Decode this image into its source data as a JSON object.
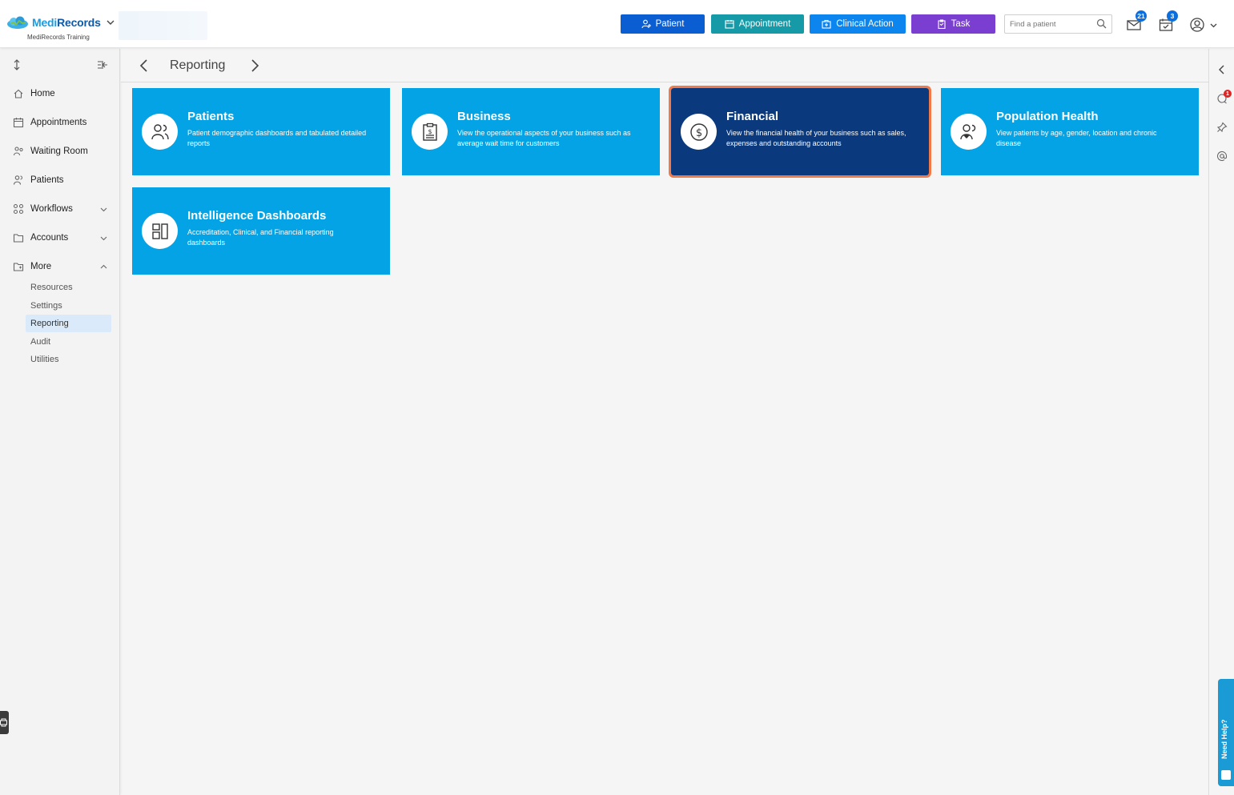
{
  "brand": {
    "name_part1": "Medi",
    "name_part2": "Records",
    "org": "MediRecords Training"
  },
  "header": {
    "buttons": [
      {
        "label": "Patient",
        "icon": "user-plus-icon"
      },
      {
        "label": "Appointment",
        "icon": "calendar-icon"
      },
      {
        "label": "Clinical Action",
        "icon": "clinical-icon"
      },
      {
        "label": "Task",
        "icon": "clipboard-icon"
      }
    ],
    "search_placeholder": "Find a patient",
    "mail_count": "21",
    "tasks_count": "3"
  },
  "sidebar": {
    "items": [
      {
        "label": "Home",
        "icon": "home-icon"
      },
      {
        "label": "Appointments",
        "icon": "calendar-icon"
      },
      {
        "label": "Waiting Room",
        "icon": "waiting-room-icon"
      },
      {
        "label": "Patients",
        "icon": "users-icon"
      },
      {
        "label": "Workflows",
        "icon": "workflow-icon"
      },
      {
        "label": "Accounts",
        "icon": "folder-icon"
      },
      {
        "label": "More",
        "icon": "more-folder-icon"
      }
    ],
    "more_sub": [
      {
        "label": "Resources"
      },
      {
        "label": "Settings"
      },
      {
        "label": "Reporting",
        "active": true
      },
      {
        "label": "Audit"
      },
      {
        "label": "Utilities"
      }
    ]
  },
  "breadcrumb": {
    "title": "Reporting"
  },
  "tiles": [
    {
      "title": "Patients",
      "desc": "Patient demographic dashboards and tabulated detailed reports",
      "icon": "users-icon"
    },
    {
      "title": "Business",
      "desc": "View the operational aspects of your business such as average wait time for customers",
      "icon": "clipboard-dollar-icon"
    },
    {
      "title": "Financial",
      "desc": "View the financial health of your business such as sales, expenses and outstanding accounts",
      "icon": "dollar-circle-icon",
      "selected": true
    },
    {
      "title": "Population Health",
      "desc": "View patients by age, gender, location and chronic disease",
      "icon": "users-heart-icon"
    },
    {
      "title": "Intelligence Dashboards",
      "desc": "Accreditation, Clinical, and Financial reporting dashboards",
      "icon": "dashboard-layout-icon"
    }
  ],
  "right_rail": {
    "notification_count": "1",
    "help_label": "Need Help?"
  },
  "colors": {
    "tile": "#04a3e5",
    "tile_selected": "#0a3a7d",
    "selected_outline": "#f07a4a"
  }
}
